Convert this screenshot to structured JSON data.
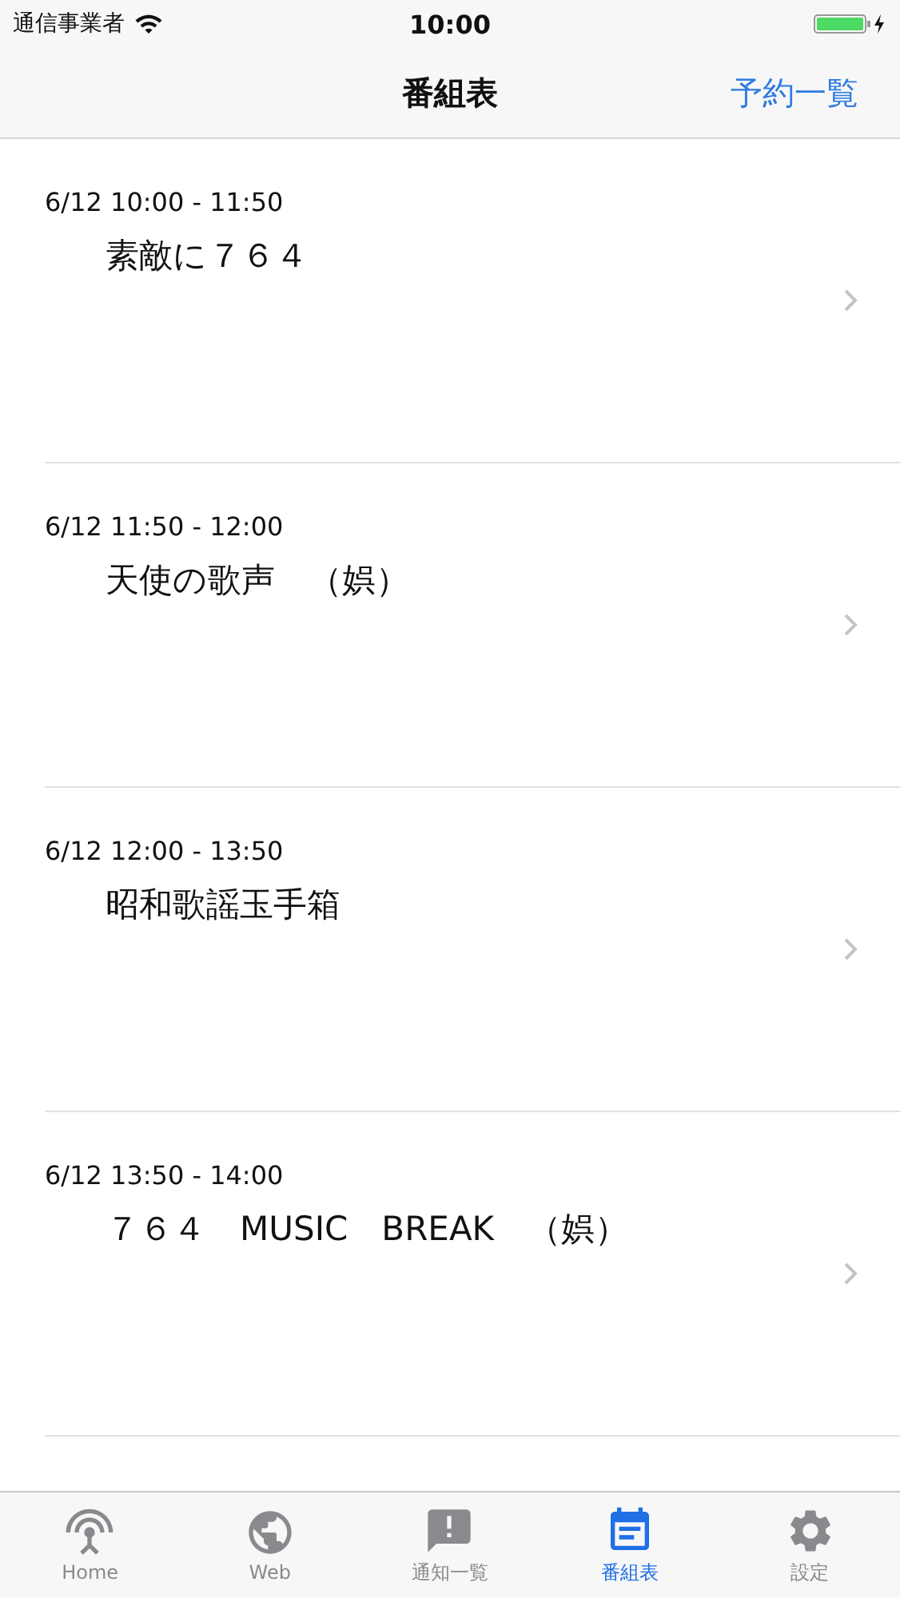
{
  "status_bar": {
    "carrier": "通信事業者",
    "time": "10:00"
  },
  "nav_bar": {
    "title": "番組表",
    "right_button": "予約一覧"
  },
  "programs": [
    {
      "time": "6/12 10:00 - 11:50",
      "title": "素敵に７６４"
    },
    {
      "time": "6/12 11:50 - 12:00",
      "title": "天使の歌声　（娯）"
    },
    {
      "time": "6/12 12:00 - 13:50",
      "title": "昭和歌謡玉手箱"
    },
    {
      "time": "6/12 13:50 - 14:00",
      "title": "７６４　MUSIC　BREAK　（娯）"
    }
  ],
  "tabs": [
    {
      "label": "Home",
      "kind": "antenna",
      "selected": false
    },
    {
      "label": "Web",
      "kind": "globe",
      "selected": false
    },
    {
      "label": "通知一覧",
      "kind": "alert",
      "selected": false
    },
    {
      "label": "番組表",
      "kind": "calendar",
      "selected": true
    },
    {
      "label": "設定",
      "kind": "gear",
      "selected": false
    }
  ]
}
